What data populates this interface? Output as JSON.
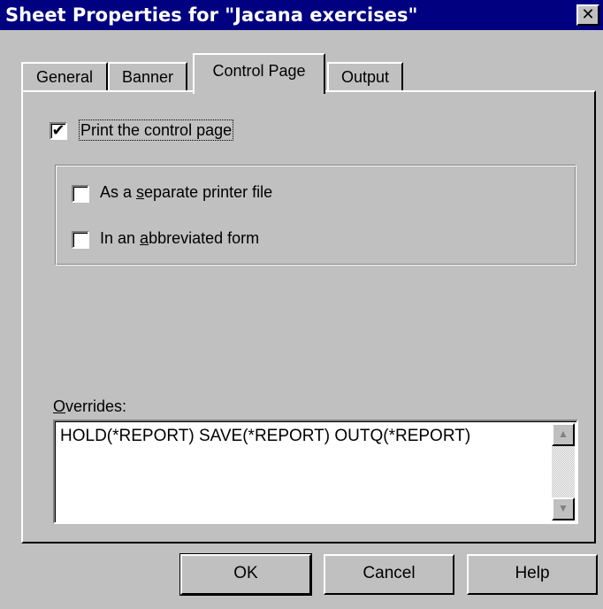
{
  "window": {
    "title": "Sheet Properties for \"Jacana exercises\"",
    "close_glyph": "✕"
  },
  "tabs": [
    {
      "label": "General",
      "active": false
    },
    {
      "label": "Banner",
      "active": false
    },
    {
      "label": "Control Page",
      "active": true
    },
    {
      "label": "Output",
      "active": false
    }
  ],
  "control_page": {
    "print_control_page": {
      "label": "Print the control page",
      "checked": true
    },
    "separate_printer_file": {
      "label_pre": "As a ",
      "label_ul": "s",
      "label_post": "eparate printer file",
      "checked": false
    },
    "abbreviated_form": {
      "label_pre": "In an ",
      "label_ul": "a",
      "label_post": "bbreviated form",
      "checked": false
    },
    "overrides": {
      "label_ul": "O",
      "label_post": "verrides:",
      "value": "HOLD(*REPORT) SAVE(*REPORT) OUTQ(*REPORT)"
    }
  },
  "buttons": {
    "ok": "OK",
    "cancel": "Cancel",
    "help": "Help"
  },
  "icons": {
    "check": "✔",
    "scroll_up": "▲",
    "scroll_down": "▼"
  },
  "colors": {
    "title_bar": "#000080",
    "face": "#c0c0c0"
  }
}
